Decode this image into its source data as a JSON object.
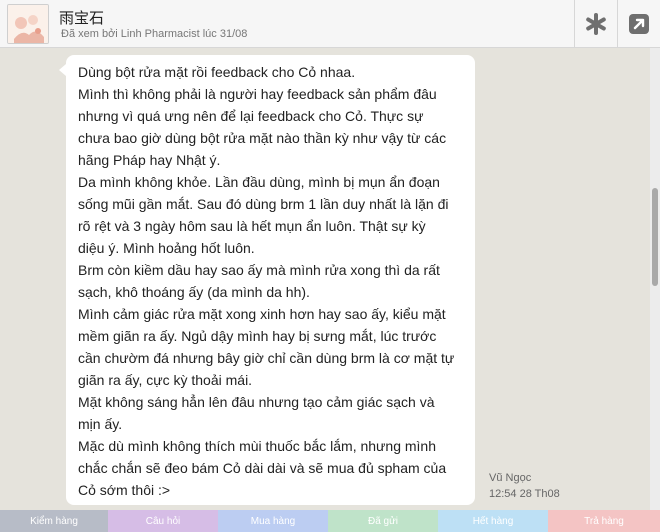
{
  "header": {
    "contact_name": "雨宝石",
    "seen_status": "Đã xem bởi Linh Pharmacist lúc 31/08",
    "menu_icon": "asterisk-icon",
    "expand_icon": "expand-arrow-icon"
  },
  "message": {
    "lines": [
      "Dùng bột rửa mặt rồi feedback cho Cỏ nhaa.",
      "Mình thì không phải là người hay feedback sản phẩm đâu",
      "nhưng vì quá ưng nên để lại feedback cho Cỏ. Thực sự",
      "chưa bao giờ dùng bột rửa mặt nào thần kỳ như vậy từ các",
      "hãng Pháp hay Nhật ý.",
      "Da mình không khỏe. Lần đầu dùng, mình bị mụn ẩn đoạn",
      "sống mũi gần mắt. Sau đó dùng brm 1 lần duy nhất là lặn đi",
      "rõ rệt và 3 ngày hôm sau là hết mụn ẩn luôn. Thật sự kỳ",
      "diệu ý. Mình hoảng hốt luôn.",
      "Brm còn kiềm dầu hay sao ấy mà mình rửa xong thì da rất",
      "sạch, khô thoáng ấy (da mình da hh).",
      "Mình cảm giác rửa mặt xong xinh hơn hay sao ấy, kiểu mặt",
      "mềm giãn ra ấy. Ngủ dậy mình hay bị sưng mắt, lúc trước",
      "cần chườm đá nhưng bây giờ chỉ cần dùng brm là cơ mặt tự",
      "giãn ra ấy, cực kỳ thoải mái.",
      "Mặt không sáng hẳn lên đâu nhưng tạo cảm giác sạch và",
      "mịn ấy.",
      "Mặc dù mình không thích mùi thuốc bắc lắm, nhưng mình",
      "chắc chắn sẽ đeo bám Cỏ dài dài và sẽ mua đủ spham của",
      "Cỏ sớm thôi :>"
    ],
    "sender": "Vũ Ngọc",
    "time": "12:54 28 Th08"
  },
  "tabs": [
    {
      "label": "Kiểm hàng",
      "color": "#b7bcc7"
    },
    {
      "label": "Câu hỏi",
      "color": "#d6bde6"
    },
    {
      "label": "Mua hàng",
      "color": "#bccdf2"
    },
    {
      "label": "Đã gửi",
      "color": "#bfe3c9"
    },
    {
      "label": "Hết hàng",
      "color": "#bde0f5"
    },
    {
      "label": "Trả hàng",
      "color": "#f4c4c4"
    }
  ]
}
